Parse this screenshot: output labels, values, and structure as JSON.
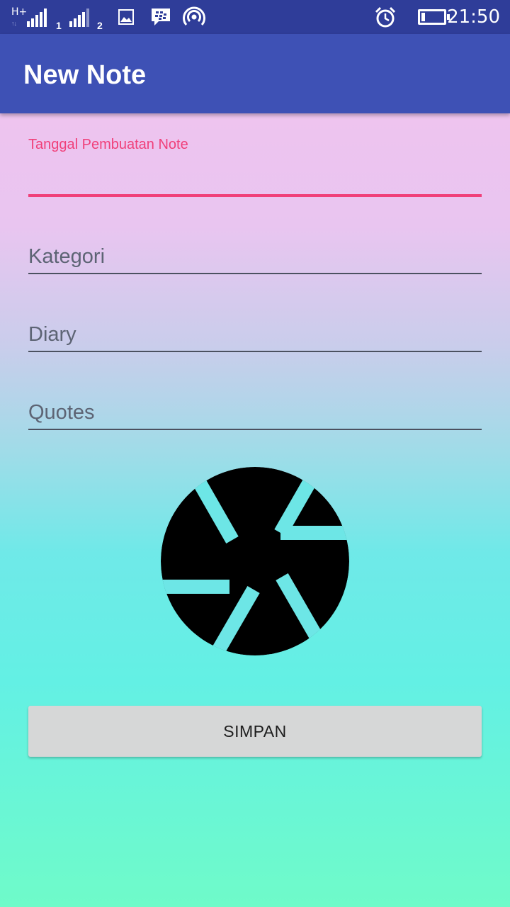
{
  "status_bar": {
    "network_type": "H+",
    "network_arrows": "↑↓",
    "sim1_label": "1",
    "sim2_label": "2",
    "time": "21:50",
    "battery_level": 0.15,
    "icons": [
      "signal-icon",
      "image-notification-icon",
      "bbm-icon",
      "hotspot-icon",
      "alarm-icon",
      "battery-icon"
    ]
  },
  "app_bar": {
    "title": "New Note",
    "color": "#3e51b5"
  },
  "form": {
    "date_field": {
      "label": "Tanggal Pembuatan Note",
      "value": ""
    },
    "kategori_field": {
      "placeholder": "Kategori",
      "value": ""
    },
    "diary_field": {
      "placeholder": "Diary",
      "value": ""
    },
    "quotes_field": {
      "placeholder": "Quotes",
      "value": ""
    },
    "accent_color": "#f0407a"
  },
  "camera_button": {
    "icon": "camera-aperture-icon"
  },
  "save_button": {
    "label": "SIMPAN"
  }
}
